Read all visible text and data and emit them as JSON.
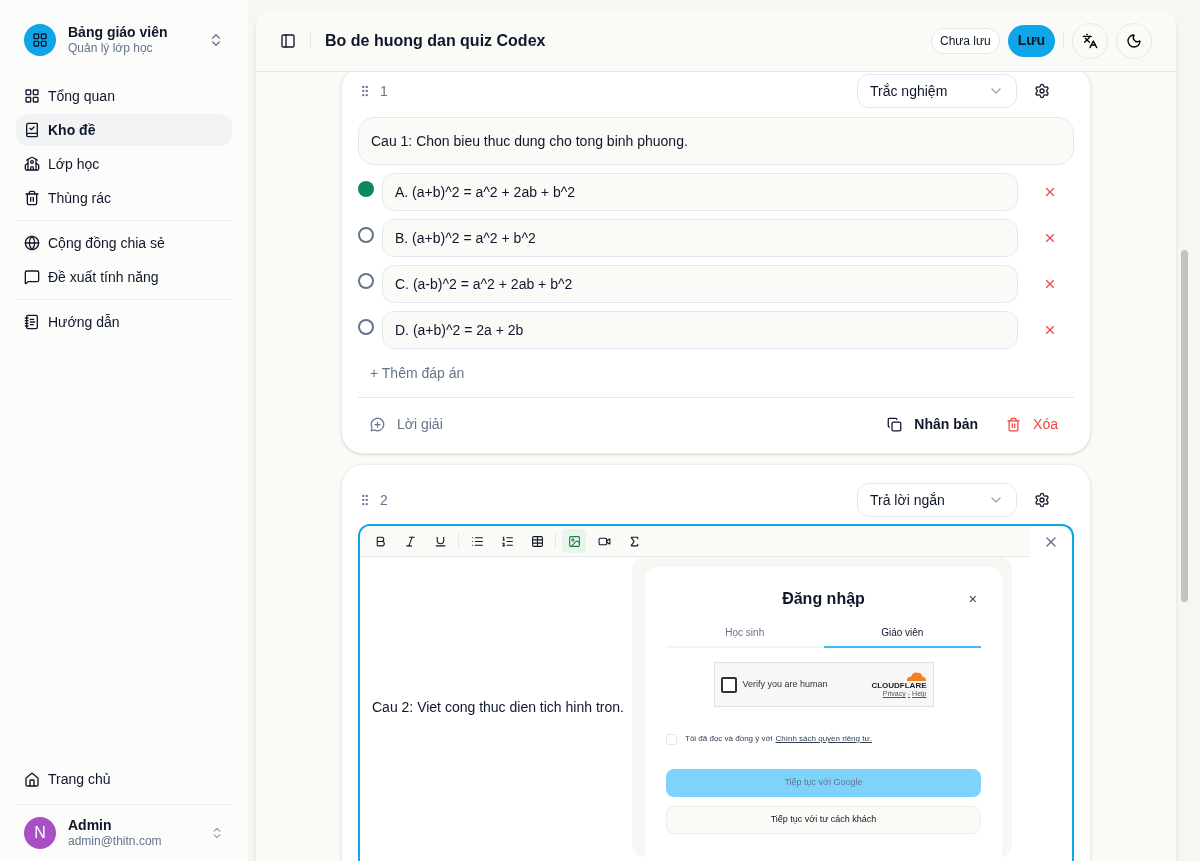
{
  "sidebar": {
    "brand": {
      "title": "Bảng giáo viên",
      "subtitle": "Quản lý lớp học"
    },
    "nav": [
      [
        {
          "label": "Tổng quan",
          "selected": false
        },
        {
          "label": "Kho đề",
          "selected": true
        },
        {
          "label": "Lớp học",
          "selected": false
        },
        {
          "label": "Thùng rác",
          "selected": false
        }
      ],
      [
        {
          "label": "Cộng đồng chia sẻ",
          "selected": false
        },
        {
          "label": "Đề xuất tính năng",
          "selected": false
        }
      ],
      [
        {
          "label": "Hướng dẫn",
          "selected": false
        }
      ]
    ],
    "home": "Trang chủ",
    "user": {
      "initial": "N",
      "name": "Admin",
      "email": "admin@thitn.com",
      "color": "#a94fc4"
    }
  },
  "header": {
    "title": "Bo de huong dan quiz Codex",
    "status": "Chưa lưu",
    "save": "Lưu"
  },
  "questions": [
    {
      "kind": "choice",
      "number": "1",
      "type": "Trắc nghiệm",
      "text": "Cau 1: Chon bieu thuc dung cho tong binh phuong.",
      "options": [
        {
          "label": "A. (a+b)^2 = a^2 + 2ab + b^2",
          "correct": true
        },
        {
          "label": "B. (a+b)^2 = a^2 + b^2",
          "correct": false
        },
        {
          "label": "C. (a-b)^2 = a^2 + 2ab + b^2",
          "correct": false
        },
        {
          "label": "D. (a+b)^2 = 2a + 2b",
          "correct": false
        }
      ],
      "add_option": "+ Thêm đáp án",
      "solution": "Lời giải",
      "duplicate": "Nhân bản",
      "delete": "Xóa"
    },
    {
      "kind": "editor",
      "number": "2",
      "type": "Trả lời ngắn",
      "toolbar": [
        {
          "selected": false
        },
        {
          "selected": false
        },
        {
          "selected": false
        },
        {
          "selected": false
        },
        {
          "selected": false
        },
        {
          "selected": false
        },
        {
          "selected": true
        },
        {
          "selected": false
        },
        {
          "selected": false
        }
      ],
      "text": "Cau 2: Viet cong thuc dien tich hinh tron.",
      "embedded_screenshot": {
        "title": "Đăng nhập",
        "close": "×",
        "tabs": [
          {
            "label": "Học sinh",
            "selected": false
          },
          {
            "label": "Giáo viên",
            "selected": true
          }
        ],
        "captcha": {
          "checked": false,
          "label": "Verify you are human",
          "brand": "CLOUDFLARE",
          "links": [
            "Privacy",
            "-",
            "Help"
          ]
        },
        "consent": {
          "checked": false,
          "text": "Tôi đã đọc và đồng ý với",
          "link": "Chính sách quyền riêng tư."
        },
        "buttons": [
          {
            "label": "Tiếp tục với Google",
            "disabled": true
          },
          {
            "label": "Tiếp tục với tư cách khách",
            "disabled": false
          }
        ]
      }
    }
  ]
}
